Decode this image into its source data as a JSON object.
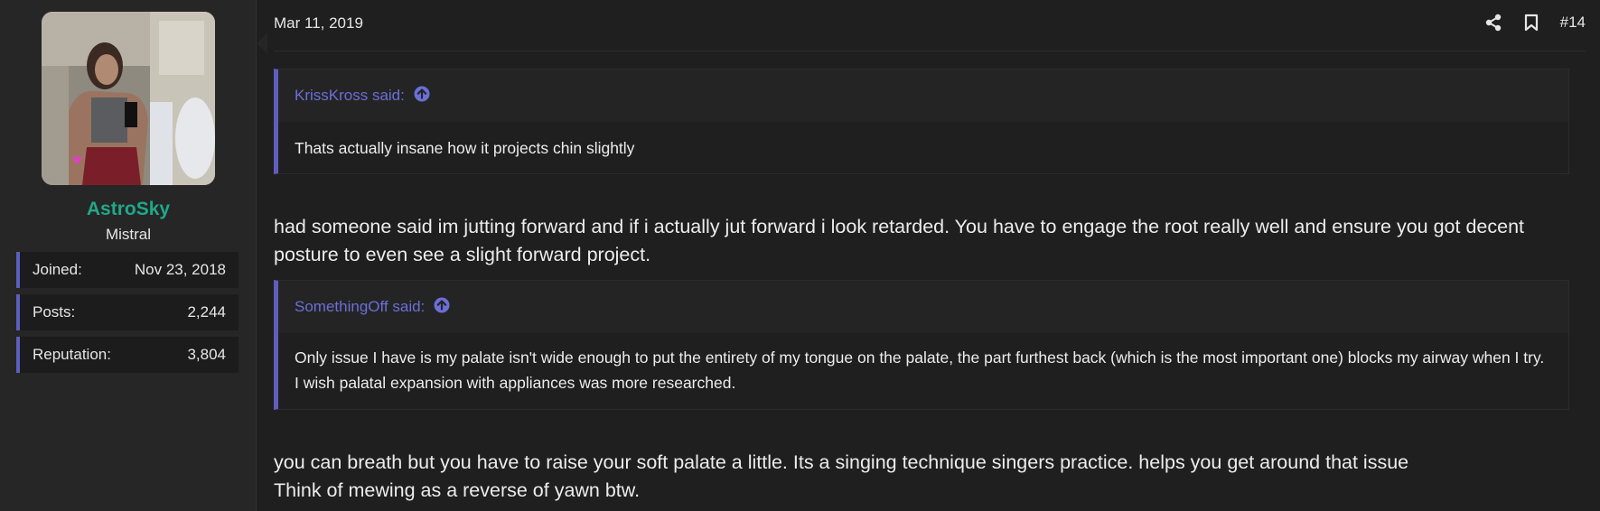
{
  "user": {
    "name": "AstroSky",
    "title": "Mistral",
    "stats": [
      {
        "label": "Joined:",
        "value": "Nov 23, 2018"
      },
      {
        "label": "Posts:",
        "value": "2,244"
      },
      {
        "label": "Reputation:",
        "value": "3,804"
      }
    ]
  },
  "post": {
    "date": "Mar 11, 2019",
    "number": "#14",
    "actions": [
      "share-icon",
      "bookmark-icon"
    ],
    "quotes": [
      {
        "author": "KrissKross said:",
        "text": "Thats actually insane how it projects chin slightly"
      },
      {
        "author": "SomethingOff said:",
        "text": "Only issue I have is my palate isn't wide enough to put the entirety of my tongue on the palate, the part furthest back (which is the most important one) blocks my airway when I try. I wish palatal expansion with appliances was more researched."
      }
    ],
    "paragraphs": [
      "had someone said im jutting forward and if i actually jut forward i look retarded. You have to engage the root really well and ensure you got decent posture to even see a slight forward project.",
      "you can breath but you have to raise your soft palate a little. Its a singing technique singers practice. helps you get around that issue\nThink of mewing as a reverse of yawn btw."
    ]
  },
  "colors": {
    "accent": "#5c5fbe",
    "quote_link": "#6b6fd8",
    "username": "#1fa88a",
    "background": "#1f1f1f"
  }
}
